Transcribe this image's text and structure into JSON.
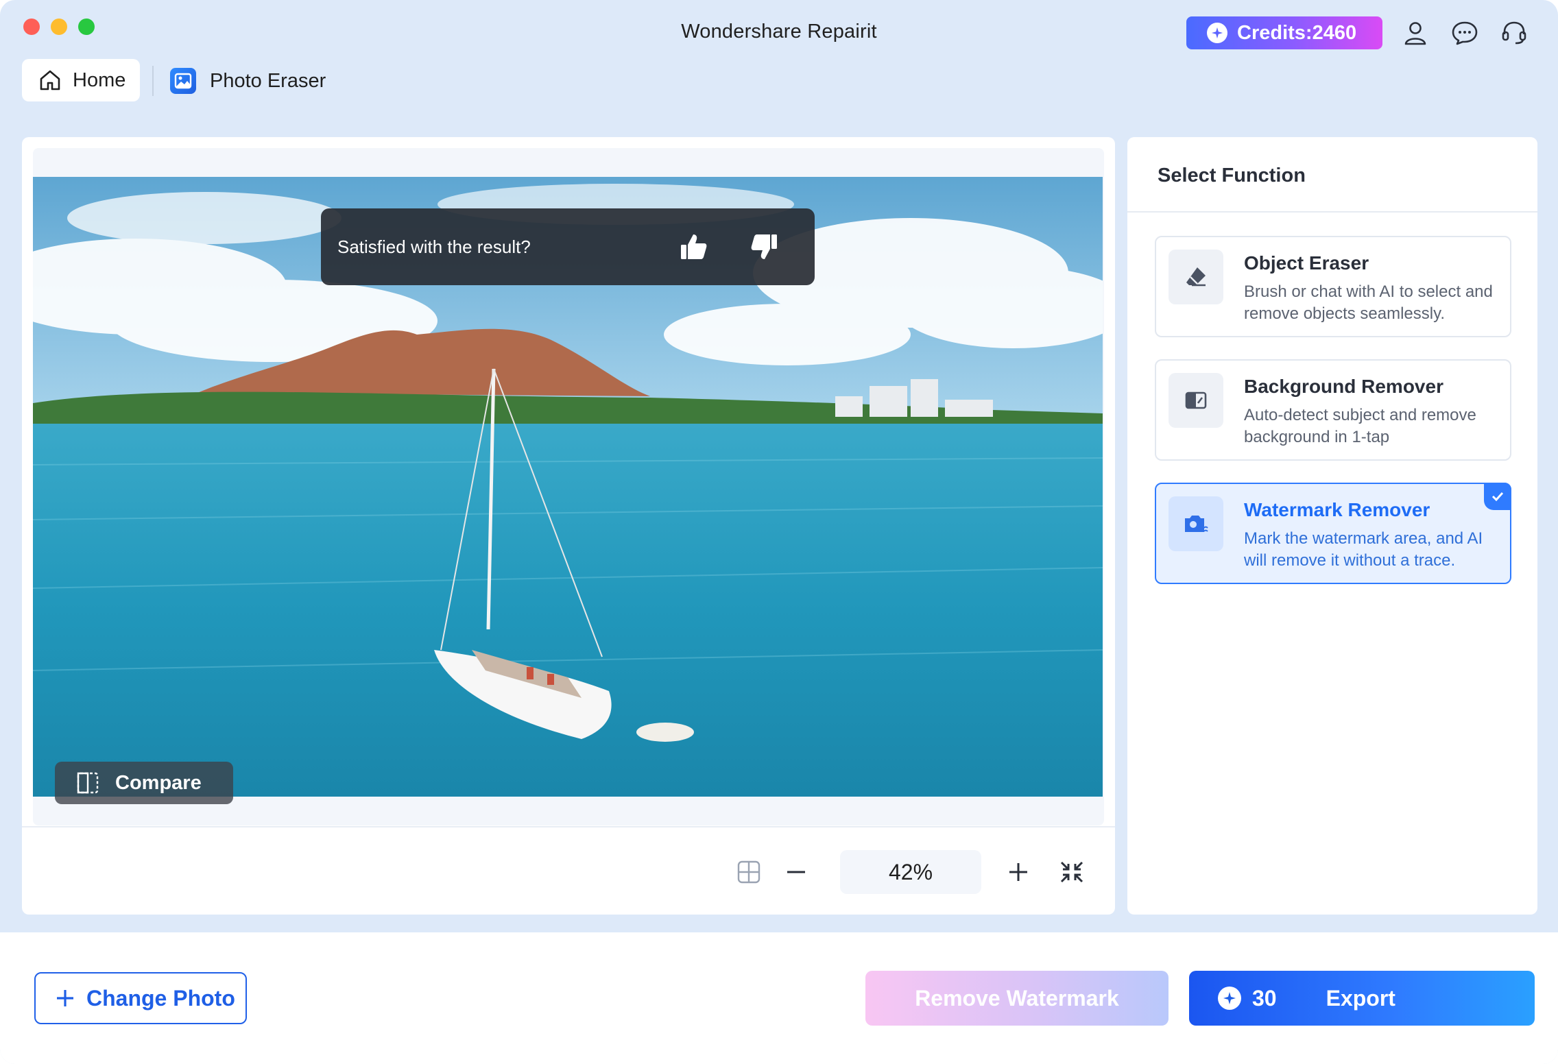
{
  "window": {
    "title": "Wondershare Repairit"
  },
  "header": {
    "credits_label": "Credits:2460",
    "icons": [
      "account-icon",
      "chat-icon",
      "support-headset-icon"
    ]
  },
  "tabs": {
    "home": "Home",
    "photo_eraser": "Photo Eraser"
  },
  "canvas": {
    "feedback_question": "Satisfied with the result?",
    "compare_label": "Compare",
    "zoom": "42%"
  },
  "side": {
    "title": "Select Function",
    "functions": [
      {
        "name": "Object Eraser",
        "desc": "Brush or chat with AI to select and remove objects seamlessly.",
        "selected": false
      },
      {
        "name": "Background Remover",
        "desc": "Auto-detect subject and remove background in 1-tap",
        "selected": false
      },
      {
        "name": "Watermark Remover",
        "desc": "Mark the watermark area, and AI will remove it without a trace.",
        "selected": true
      }
    ]
  },
  "bottom": {
    "change_photo": "Change Photo",
    "remove_watermark": "Remove Watermark",
    "export_cost": "30",
    "export_label": "Export"
  },
  "colors": {
    "accent": "#2f7bff",
    "window_bg": "#dde9f9",
    "credits_gradient_start": "#4a6bff",
    "credits_gradient_end": "#d94bf5"
  }
}
